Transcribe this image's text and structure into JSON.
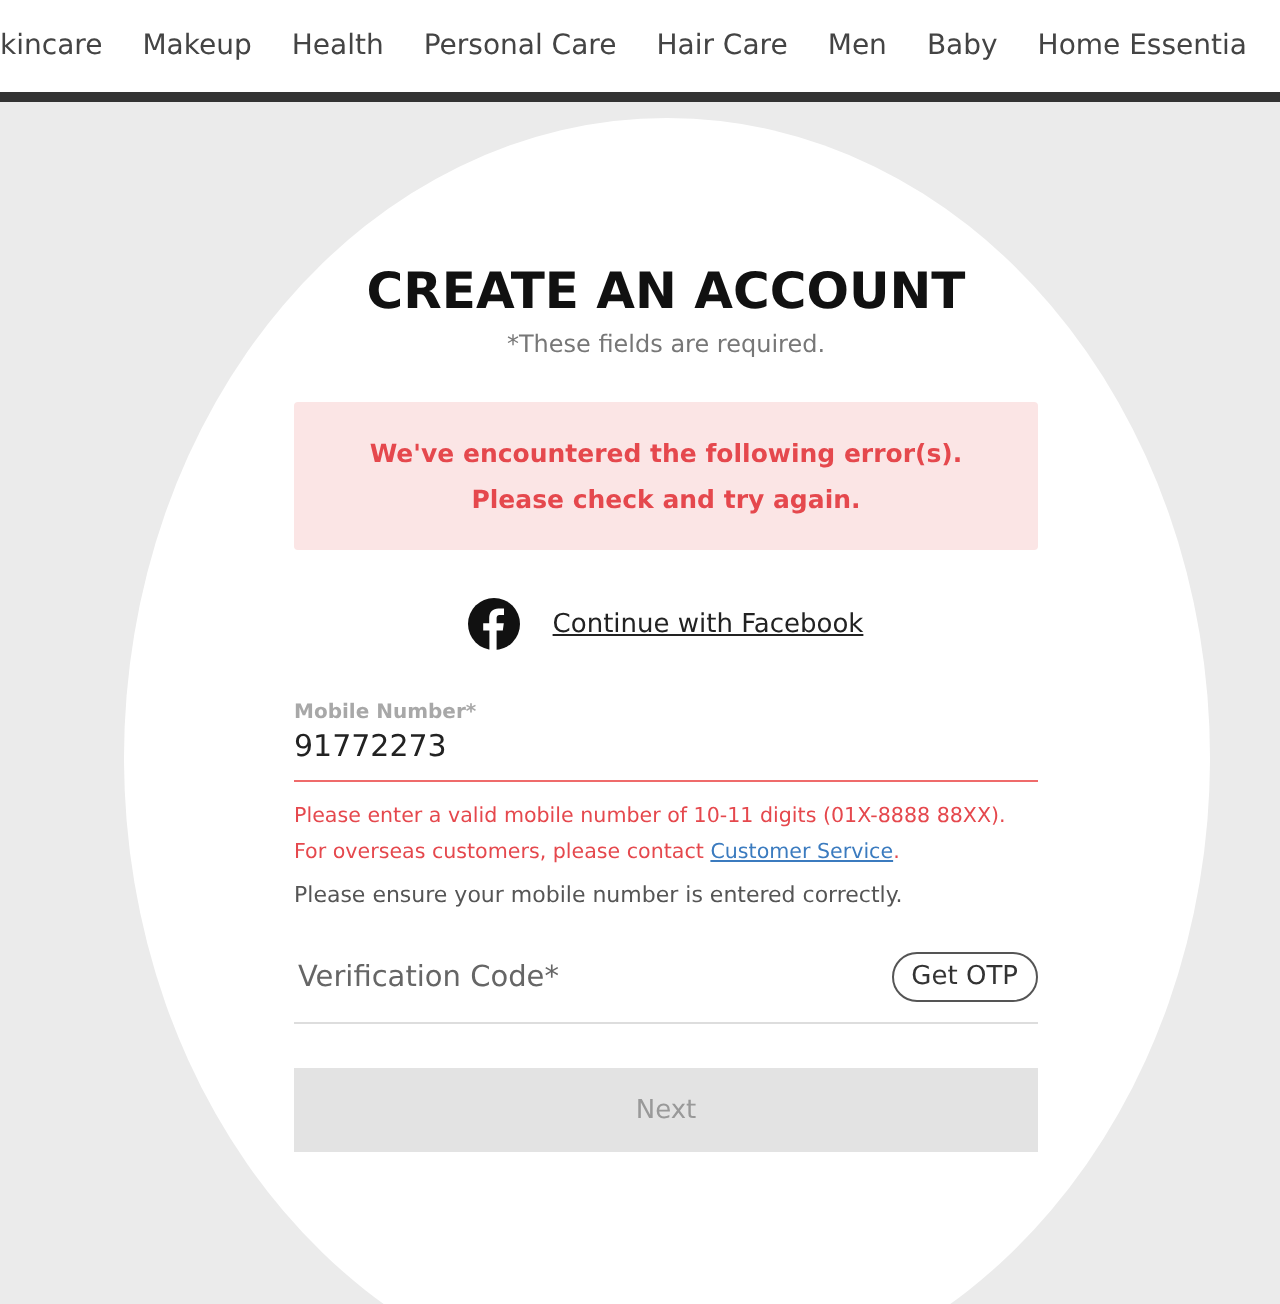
{
  "nav": {
    "items": [
      "kincare",
      "Makeup",
      "Health",
      "Personal Care",
      "Hair Care",
      "Men",
      "Baby",
      "Home Essentia"
    ]
  },
  "form": {
    "title": "CREATE AN ACCOUNT",
    "required_note": "*These fields are required.",
    "error_banner": "We've encountered the following error(s). Please check and try again.",
    "facebook_link": "Continue with Facebook",
    "mobile": {
      "label": "Mobile Number*",
      "value": "91772273",
      "invalid": true,
      "error_lines": [
        {
          "text": "Please enter a valid mobile number of 10-11 digits (01X-8888 88XX)."
        },
        {
          "text": "For overseas customers, please contact ",
          "link": "Customer Service",
          "after": "."
        }
      ],
      "hint": "Please ensure your mobile number is entered correctly."
    },
    "verification": {
      "placeholder": "Verification Code*",
      "button": "Get OTP"
    },
    "next_button": {
      "label": "Next",
      "disabled": true
    }
  }
}
